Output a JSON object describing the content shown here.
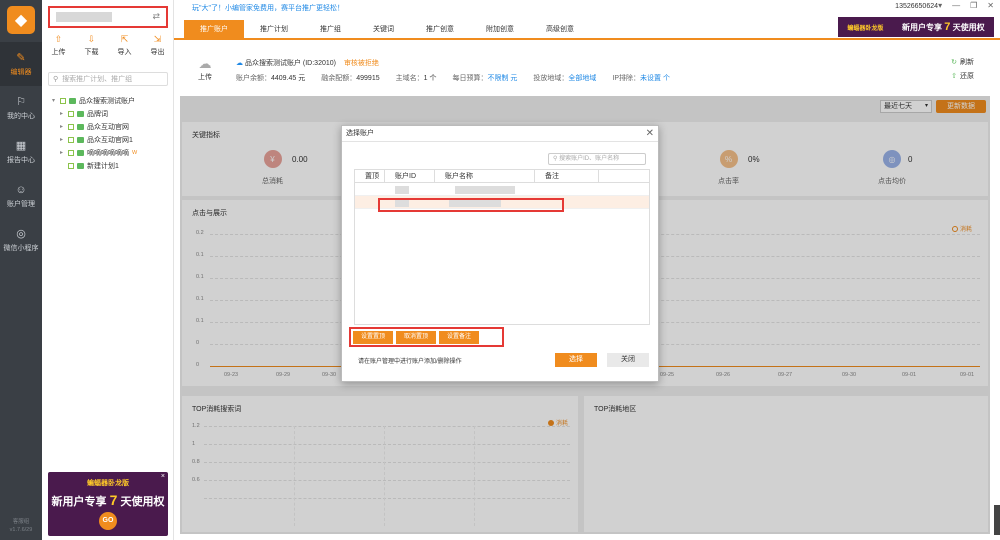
{
  "rail": {
    "logo": "◆",
    "items": [
      {
        "icon": "✎",
        "label": "编辑器"
      },
      {
        "icon": "⚐",
        "label": "我的中心"
      },
      {
        "icon": "▦",
        "label": "报告中心"
      },
      {
        "icon": "☺",
        "label": "账户管理"
      },
      {
        "icon": "◎",
        "label": "微信小程序"
      }
    ],
    "version": "客服组\nv1.7.6/29"
  },
  "sidebar": {
    "switch_icon": "⇄",
    "tools": [
      {
        "icon": "⇧",
        "label": "上传"
      },
      {
        "icon": "⇩",
        "label": "下载"
      },
      {
        "icon": "⇱",
        "label": "导入"
      },
      {
        "icon": "⇲",
        "label": "导出"
      }
    ],
    "search_placeholder": "搜索推广计划、推广组",
    "tree": [
      {
        "label": "品众搜索测试账户",
        "level": 0,
        "tag": ""
      },
      {
        "label": "品牌词",
        "level": 1,
        "tag": ""
      },
      {
        "label": "品众互动官网",
        "level": 1,
        "tag": ""
      },
      {
        "label": "品众互动官网1",
        "level": 1,
        "tag": ""
      },
      {
        "label": "嘀嘀嘀嘀嘀嘀",
        "level": 1,
        "tag": "W"
      },
      {
        "label": "新建计划1",
        "level": 1,
        "tag": ""
      }
    ],
    "promo": {
      "line1": "蝙蝠器卧龙版",
      "line2a": "新用户专享",
      "line2b": "7",
      "line2c": "天使用权",
      "go": "GO",
      "close": "×"
    }
  },
  "topbar": {
    "notice": "玩\"大\"了！小编管家免费用，赛平台推广更轻松！",
    "phone": "13526650624",
    "controls": [
      "▾",
      "—",
      "❐",
      "✕"
    ]
  },
  "tabs": [
    "推广账户",
    "推广计划",
    "推广组",
    "关键词",
    "推广创意",
    "附加创意",
    "高级创意"
  ],
  "banner": {
    "b1": "蝙蝠器卧龙版",
    "text_a": "新用户专享",
    "num": "7",
    "text_b": "天使用权"
  },
  "info": {
    "upload_label": "上传",
    "account_name": "品众搜索测试账户 (ID:32010)",
    "status": "审核被拒绝",
    "fields": [
      {
        "label": "账户余额：",
        "value": "4409.45 元"
      },
      {
        "label": "融余配额：",
        "value": "499915"
      },
      {
        "label": "主域名：",
        "value": "1 个"
      },
      {
        "label": "每日预算：",
        "value": "不限制 元"
      },
      {
        "label": "投放地域：",
        "value": "全部地域"
      },
      {
        "label": "IP排除：",
        "value": "未设置 个"
      }
    ],
    "refresh": "刷新",
    "restore": "还原"
  },
  "main": {
    "filter": "最近七天",
    "update_btn": "更新数据",
    "kpi_title": "关键指标",
    "kpis": [
      {
        "icon": "¥",
        "value": "0.00",
        "label": "总消耗",
        "color": "#e8a39a"
      },
      {
        "icon": "%",
        "value": "0%",
        "label": "点击率",
        "color": "#f5c08a"
      },
      {
        "icon": "◎",
        "value": "0",
        "label": "点击均价",
        "color": "#9ab3e8"
      }
    ],
    "chart1_title": "点击与展示",
    "chart1_legend": "消耗",
    "chart1_yticks": [
      "0.2",
      "0.1",
      "0.1",
      "0.1",
      "0.1",
      "0",
      "0"
    ],
    "chart1_xticks": [
      "09-23",
      "09-29",
      "09-30",
      "09-25",
      "09-26",
      "09-27",
      "09-30",
      "09-01",
      "09-01",
      "09-01",
      "09-01",
      "09-01"
    ],
    "top_kw_title": "TOP消耗搜索词",
    "top_kw_legend": "消耗",
    "top_kw_yticks": [
      "1.2",
      "1",
      "0.8",
      "0.6"
    ],
    "top_region_title": "TOP消耗地区"
  },
  "modal": {
    "title": "选择账户",
    "close": "✕",
    "search_placeholder": "搜索账户ID、账户名称",
    "columns": [
      "置顶",
      "账户ID",
      "账户名称",
      "备注"
    ],
    "buttons": [
      "设置置顶",
      "取消置顶",
      "设置备注"
    ],
    "hint": "请在账户管理中进行账户添加/删除操作",
    "select": "选择",
    "close_btn": "关闭"
  }
}
